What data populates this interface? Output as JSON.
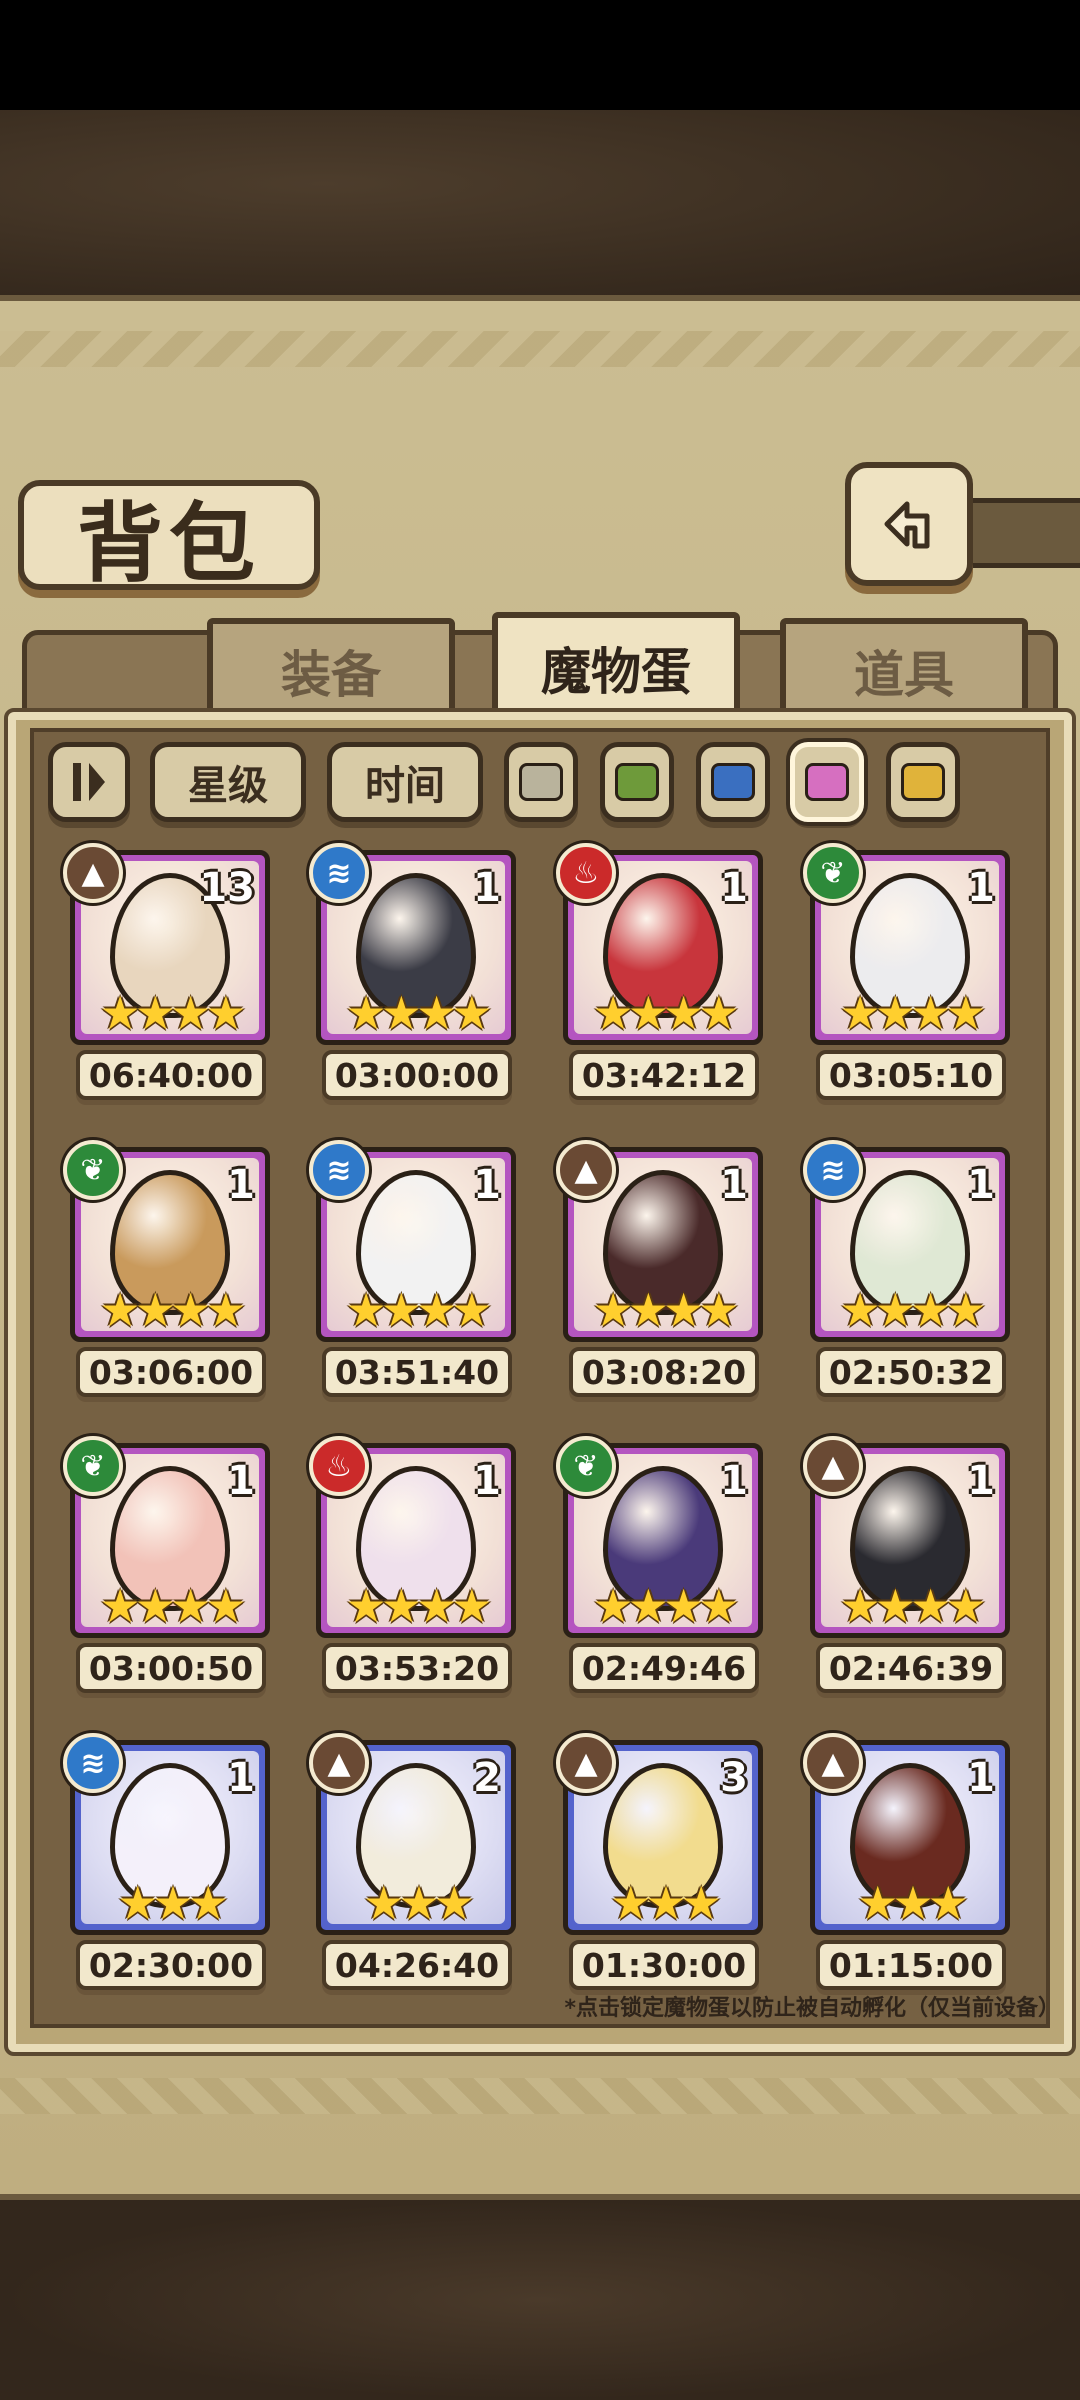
{
  "header": {
    "title": "背包",
    "back_icon": "return-arrow-icon"
  },
  "tabs": [
    {
      "label": "装备",
      "active": false
    },
    {
      "label": "魔物蛋",
      "active": true
    },
    {
      "label": "道具",
      "active": false
    }
  ],
  "filters": {
    "sort_icon": "sort-toggle-icon",
    "star_label": "星级",
    "time_label": "时间",
    "colors": [
      "#b9b39c",
      "#6e9a3a",
      "#3a6fc0",
      "#d66fc0",
      "#e0b33a"
    ],
    "selected_color": "#d66fc0"
  },
  "eggs": [
    {
      "element": "earth",
      "count": "13",
      "stars": "★★★★",
      "timer": "06:40:00",
      "rarity": "purple",
      "egg_color": "#e8d6be"
    },
    {
      "element": "water",
      "count": "1",
      "stars": "★★★★",
      "timer": "03:00:00",
      "rarity": "purple",
      "egg_color": "#3b3c46"
    },
    {
      "element": "fire",
      "count": "1",
      "stars": "★★★★",
      "timer": "03:42:12",
      "rarity": "purple",
      "egg_color": "#c8353c"
    },
    {
      "element": "grass",
      "count": "1",
      "stars": "★★★★",
      "timer": "03:05:10",
      "rarity": "purple",
      "egg_color": "#ececee"
    },
    {
      "element": "grass",
      "count": "1",
      "stars": "★★★★",
      "timer": "03:06:00",
      "rarity": "purple",
      "egg_color": "#c99a5c"
    },
    {
      "element": "water",
      "count": "1",
      "stars": "★★★★",
      "timer": "03:51:40",
      "rarity": "purple",
      "egg_color": "#f2f2f2"
    },
    {
      "element": "earth",
      "count": "1",
      "stars": "★★★★",
      "timer": "03:08:20",
      "rarity": "purple",
      "egg_color": "#4a2a2a"
    },
    {
      "element": "water",
      "count": "1",
      "stars": "★★★★",
      "timer": "02:50:32",
      "rarity": "purple",
      "egg_color": "#dfe8d4"
    },
    {
      "element": "grass",
      "count": "1",
      "stars": "★★★★",
      "timer": "03:00:50",
      "rarity": "purple",
      "egg_color": "#f2c2b8"
    },
    {
      "element": "fire",
      "count": "1",
      "stars": "★★★★",
      "timer": "03:53:20",
      "rarity": "purple",
      "egg_color": "#efe0ec"
    },
    {
      "element": "grass",
      "count": "1",
      "stars": "★★★★",
      "timer": "02:49:46",
      "rarity": "purple",
      "egg_color": "#4a3a7a"
    },
    {
      "element": "earth",
      "count": "1",
      "stars": "★★★★",
      "timer": "02:46:39",
      "rarity": "purple",
      "egg_color": "#2a2a30"
    },
    {
      "element": "water",
      "count": "1",
      "stars": "★★★",
      "timer": "02:30:00",
      "rarity": "blue",
      "egg_color": "#f4f0fa"
    },
    {
      "element": "earth",
      "count": "2",
      "stars": "★★★",
      "timer": "04:26:40",
      "rarity": "blue",
      "egg_color": "#f2ecdc"
    },
    {
      "element": "earth",
      "count": "3",
      "stars": "★★★",
      "timer": "01:30:00",
      "rarity": "blue",
      "egg_color": "#f2dc8e"
    },
    {
      "element": "earth",
      "count": "1",
      "stars": "★★★",
      "timer": "01:15:00",
      "rarity": "blue",
      "egg_color": "#6a2a20"
    }
  ],
  "element_icons": {
    "earth": "mountain-icon",
    "water": "water-waves-icon",
    "fire": "flame-icon",
    "grass": "leaf-icon"
  },
  "footer_note": "*点击锁定魔物蛋以防止被自动孵化（仅当前设备）"
}
